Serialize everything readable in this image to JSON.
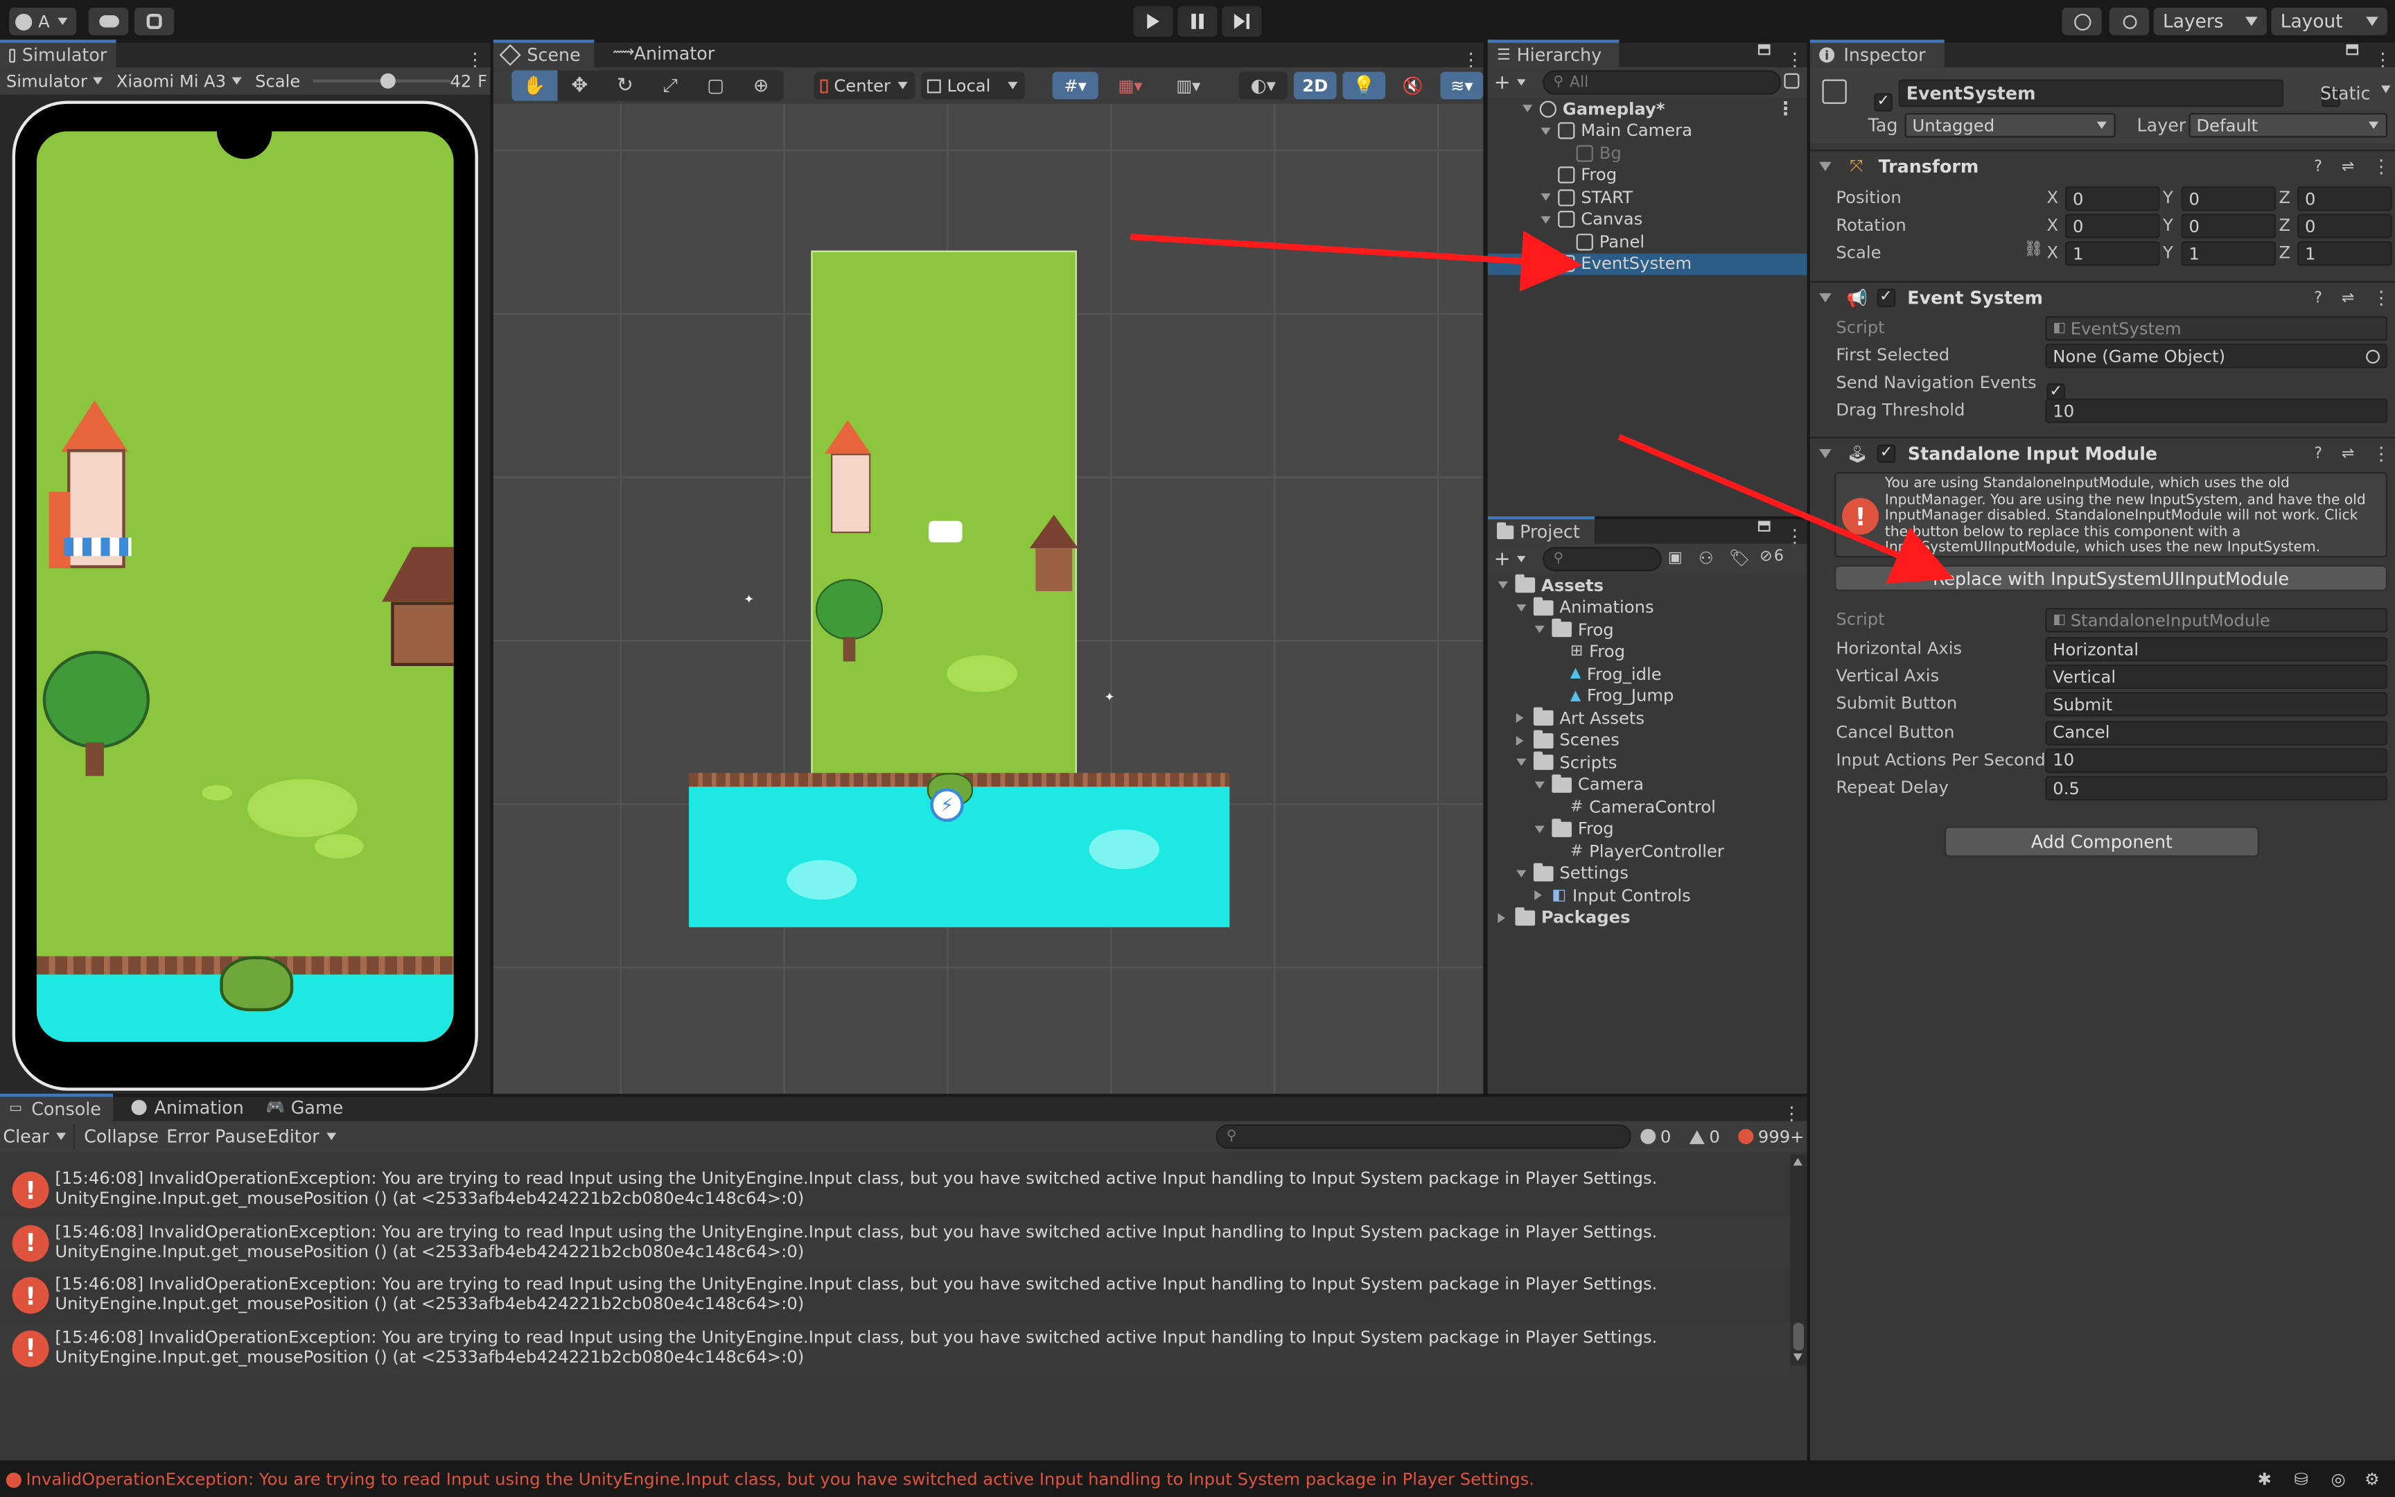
{
  "toolbar": {
    "account": "A",
    "layers": "Layers",
    "layout": "Layout"
  },
  "simulator": {
    "tab": "Simulator",
    "mode": "Simulator",
    "device": "Xiaomi Mi A3",
    "scale_label": "Scale",
    "scale_value": "42",
    "scale_fraction": 0.55
  },
  "scene": {
    "tabs": [
      "Scene",
      "Animator"
    ],
    "pivot": "Center",
    "space": "Local",
    "mode_2d": "2D"
  },
  "hierarchy": {
    "tab": "Hierarchy",
    "search_placeholder": "All",
    "items": [
      {
        "label": "Gameplay*",
        "depth": 0
      },
      {
        "label": "Main Camera",
        "depth": 1
      },
      {
        "label": "Bg",
        "depth": 2
      },
      {
        "label": "Frog",
        "depth": 1
      },
      {
        "label": "START",
        "depth": 1
      },
      {
        "label": "Canvas",
        "depth": 1
      },
      {
        "label": "Panel",
        "depth": 2
      },
      {
        "label": "EventSystem",
        "depth": 1
      }
    ]
  },
  "project": {
    "tab": "Project",
    "hidden_count": "6",
    "items": [
      {
        "label": "Assets",
        "depth": 0,
        "type": "folder"
      },
      {
        "label": "Animations",
        "depth": 1,
        "type": "folder"
      },
      {
        "label": "Frog",
        "depth": 2,
        "type": "folder"
      },
      {
        "label": "Frog",
        "depth": 3,
        "type": "controller"
      },
      {
        "label": "Frog_idle",
        "depth": 3,
        "type": "anim"
      },
      {
        "label": "Frog_Jump",
        "depth": 3,
        "type": "anim"
      },
      {
        "label": "Art Assets",
        "depth": 1,
        "type": "folder"
      },
      {
        "label": "Scenes",
        "depth": 1,
        "type": "folder"
      },
      {
        "label": "Scripts",
        "depth": 1,
        "type": "folder"
      },
      {
        "label": "Camera",
        "depth": 2,
        "type": "folder"
      },
      {
        "label": "CameraControl",
        "depth": 3,
        "type": "script"
      },
      {
        "label": "Frog",
        "depth": 2,
        "type": "folder"
      },
      {
        "label": "PlayerController",
        "depth": 3,
        "type": "script"
      },
      {
        "label": "Settings",
        "depth": 1,
        "type": "folder"
      },
      {
        "label": "Input Controls",
        "depth": 2,
        "type": "asset"
      },
      {
        "label": "Packages",
        "depth": 0,
        "type": "folder"
      }
    ]
  },
  "inspector": {
    "tab": "Inspector",
    "object_name": "EventSystem",
    "static_label": "Static",
    "tag_label": "Tag",
    "tag_value": "Untagged",
    "layer_label": "Layer",
    "layer_value": "Default",
    "transform": {
      "title": "Transform",
      "position_label": "Position",
      "rotation_label": "Rotation",
      "scale_label": "Scale",
      "position": [
        "0",
        "0",
        "0"
      ],
      "rotation": [
        "0",
        "0",
        "0"
      ],
      "scale": [
        "1",
        "1",
        "1"
      ]
    },
    "event_system": {
      "title": "Event System",
      "script_label": "Script",
      "script_value": "EventSystem",
      "first_selected_label": "First Selected",
      "first_selected_value": "None (Game Object)",
      "send_nav_label": "Send Navigation Events",
      "drag_label": "Drag Threshold",
      "drag_value": "10"
    },
    "standalone": {
      "title": "Standalone Input Module",
      "warning": "You are using StandaloneInputModule, which uses the old InputManager. You are using the new InputSystem, and have the old InputManager disabled. StandaloneInputModule will not work. Click the button below to replace this component with a InputSystemUIInputModule, which uses the new InputSystem.",
      "replace_button": "Replace with InputSystemUIInputModule",
      "script_label": "Script",
      "script_value": "StandaloneInputModule",
      "fields": [
        {
          "label": "Horizontal Axis",
          "value": "Horizontal"
        },
        {
          "label": "Vertical Axis",
          "value": "Vertical"
        },
        {
          "label": "Submit Button",
          "value": "Submit"
        },
        {
          "label": "Cancel Button",
          "value": "Cancel"
        },
        {
          "label": "Input Actions Per Second",
          "value": "10"
        },
        {
          "label": "Repeat Delay",
          "value": "0.5"
        }
      ]
    },
    "add_component": "Add Component"
  },
  "console": {
    "tabs": [
      "Console",
      "Animation",
      "Game"
    ],
    "clear": "Clear",
    "collapse": "Collapse",
    "error_pause": "Error Pause",
    "editor": "Editor",
    "count_log": "0",
    "count_warn": "0",
    "count_error": "999+",
    "messages": [
      {
        "line1": "[15:46:08] InvalidOperationException: You are trying to read Input using the UnityEngine.Input class, but you have switched active Input handling to Input System package in Player Settings.",
        "line2": "UnityEngine.Input.get_mousePosition () (at <2533afb4eb424221b2cb080e4c148c64>:0)"
      },
      {
        "line1": "[15:46:08] InvalidOperationException: You are trying to read Input using the UnityEngine.Input class, but you have switched active Input handling to Input System package in Player Settings.",
        "line2": "UnityEngine.Input.get_mousePosition () (at <2533afb4eb424221b2cb080e4c148c64>:0)"
      },
      {
        "line1": "[15:46:08] InvalidOperationException: You are trying to read Input using the UnityEngine.Input class, but you have switched active Input handling to Input System package in Player Settings.",
        "line2": "UnityEngine.Input.get_mousePosition () (at <2533afb4eb424221b2cb080e4c148c64>:0)"
      },
      {
        "line1": "[15:46:08] InvalidOperationException: You are trying to read Input using the UnityEngine.Input class, but you have switched active Input handling to Input System package in Player Settings.",
        "line2": "UnityEngine.Input.get_mousePosition () (at <2533afb4eb424221b2cb080e4c148c64>:0)"
      }
    ]
  },
  "statusbar": {
    "message": "InvalidOperationException: You are trying to read Input using the UnityEngine.Input class, but you have switched active Input handling to Input System package in Player Settings."
  },
  "colors": {
    "accent": "#2c5d87",
    "error": "#e0533d",
    "grass": "#8cc63f",
    "water": "#1de9e2"
  }
}
